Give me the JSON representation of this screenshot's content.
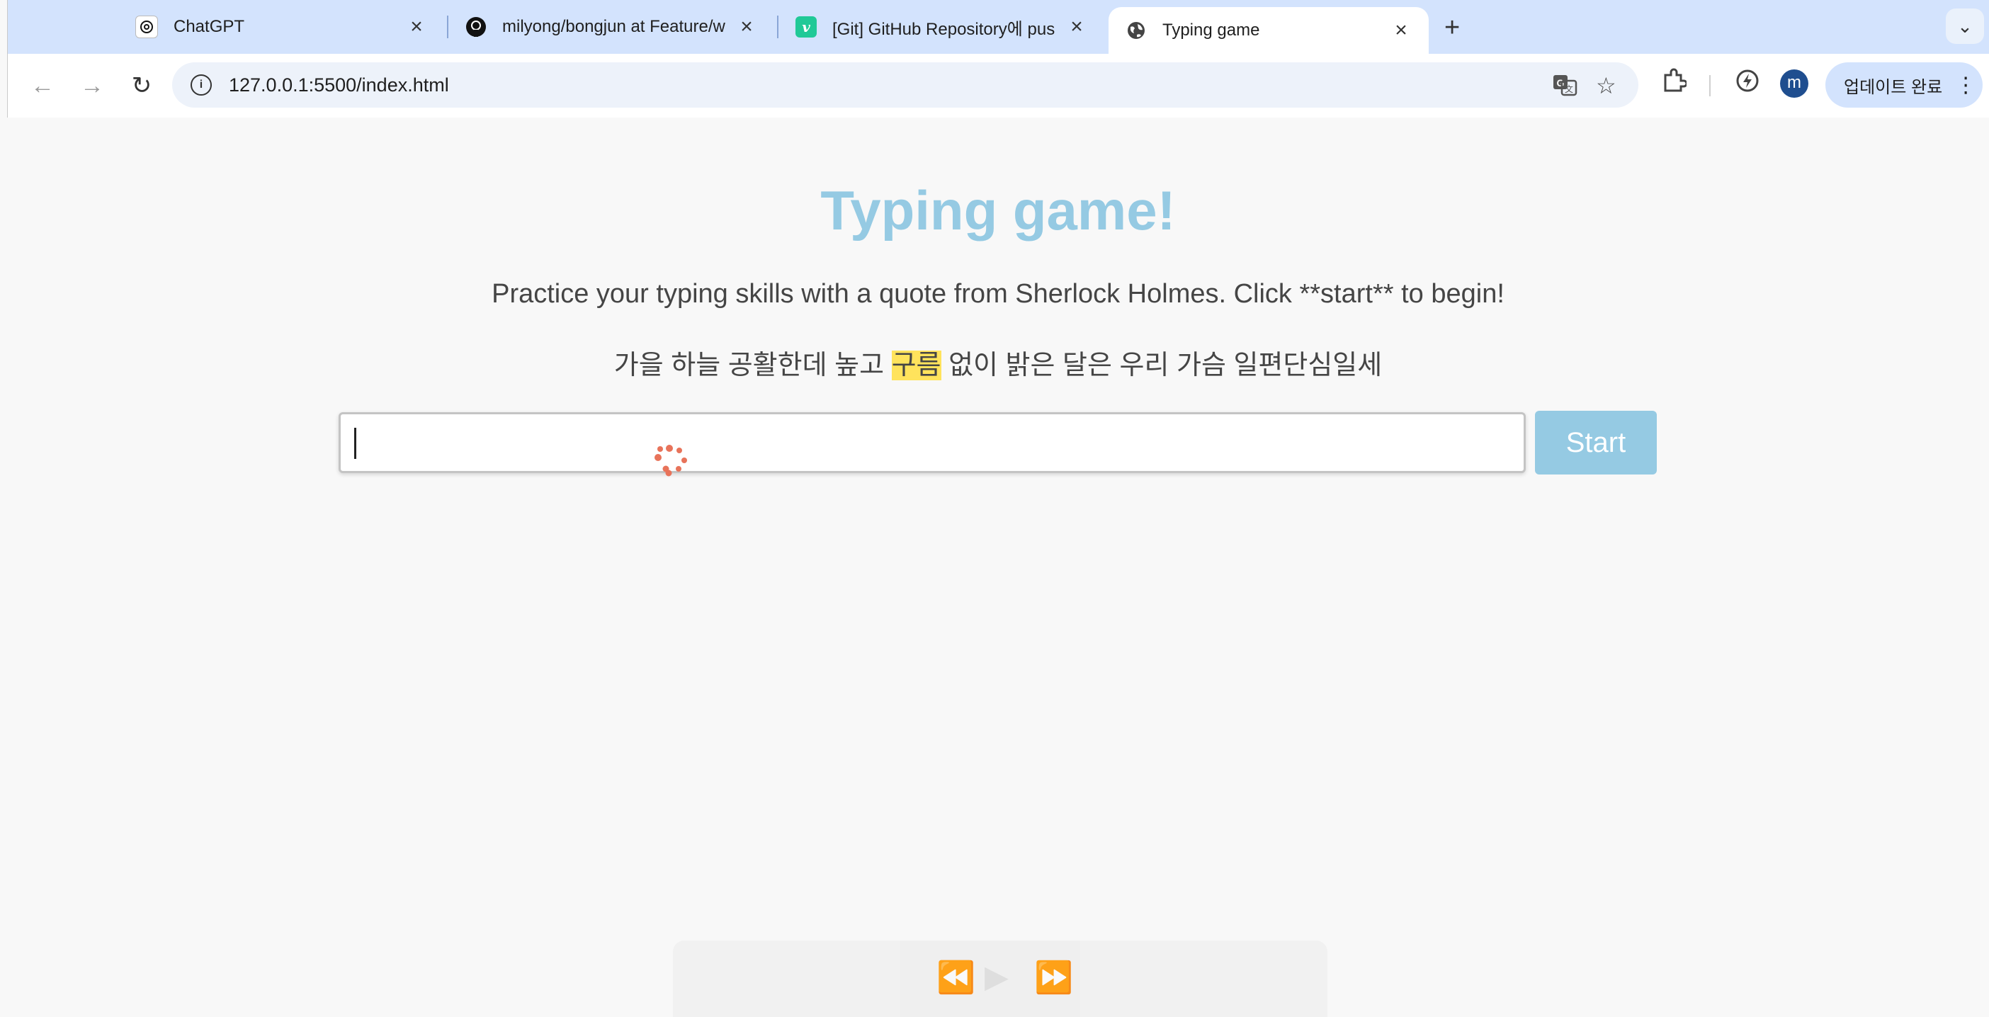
{
  "tabs": [
    {
      "title": "ChatGPT",
      "favicon": "chatgpt-icon",
      "active": false
    },
    {
      "title": "milyong/bongjun at Feature/w",
      "favicon": "github-icon",
      "active": false
    },
    {
      "title": "[Git] GitHub Repository에 pus",
      "favicon": "velog-icon",
      "active": false
    },
    {
      "title": "Typing game",
      "favicon": "globe-icon",
      "active": true
    }
  ],
  "omnibox": {
    "url": "127.0.0.1:5500/index.html"
  },
  "toolbar": {
    "avatar_letter": "m",
    "update_label": "업데이트 완료"
  },
  "page": {
    "title": "Typing game!",
    "description": "Practice your typing skills with a quote from Sherlock Holmes. Click **start** to begin!",
    "quote_before": "가을 하늘 공활한데 높고 ",
    "quote_highlight": "구름",
    "quote_after": " 없이 밝은 달은 우리 가슴 일편단심일세",
    "input_value": "",
    "start_label": "Start"
  },
  "colors": {
    "accent": "#95cae3",
    "highlight": "#ffe35c",
    "tabstrip": "#d3e3fd",
    "spinner": "#e8735a"
  },
  "icons": [
    "back-icon",
    "forward-icon",
    "reload-icon",
    "info-icon",
    "translate-icon",
    "star-icon",
    "extensions-icon",
    "performance-icon",
    "menu-icon",
    "loading-spinner-icon"
  ]
}
